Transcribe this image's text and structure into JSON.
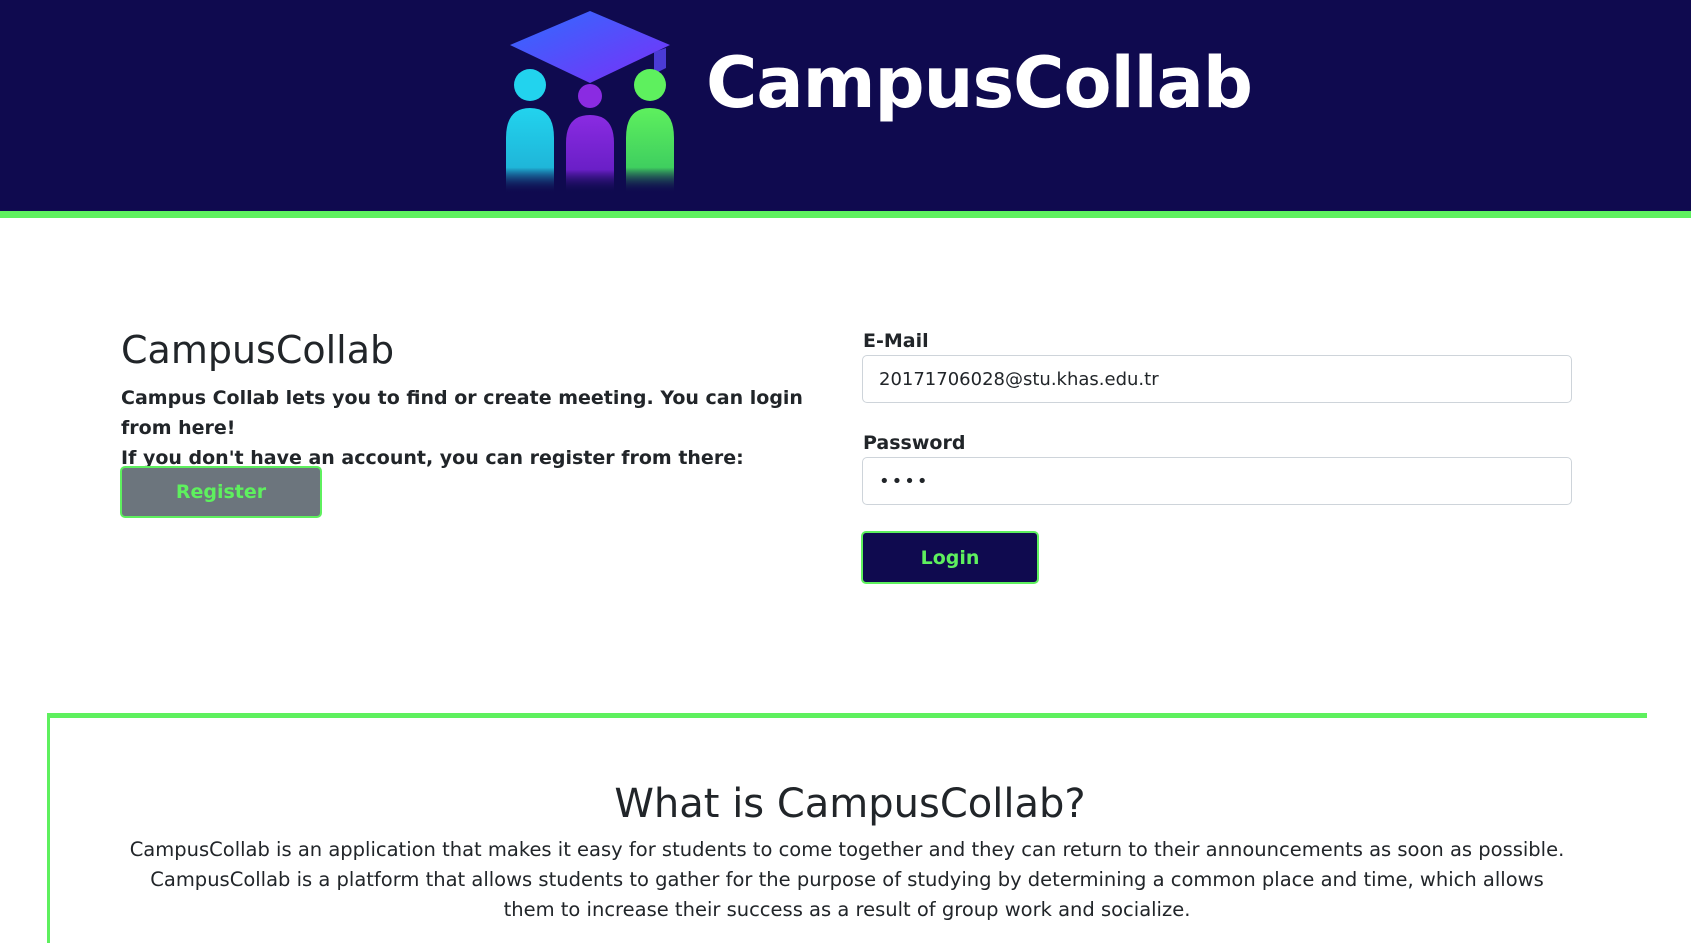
{
  "header": {
    "brand": "CampusCollab",
    "logo_icon": "graduation-cap-students-icon",
    "colors": {
      "background": "#0f0a4f",
      "accent": "#5ef05e"
    }
  },
  "intro": {
    "title": "CampusCollab",
    "line1": "Campus Collab lets you to find or create meeting. You can login from here!",
    "line2": "If you don't have an account, you can register from there:",
    "register_label": "Register"
  },
  "login": {
    "email_label": "E-Mail",
    "email_value": "20171706028@stu.khas.edu.tr",
    "password_label": "Password",
    "password_value": "••••",
    "login_label": "Login"
  },
  "about": {
    "title": "What is CampusCollab?",
    "text": "CampusCollab is an application that makes it easy for students to come together and they can return to their announcements as soon as possible. CampusCollab is a platform that allows students to gather for the purpose of studying by determining a common place and time, which allows them to increase their success as a result of group work and socialize."
  }
}
